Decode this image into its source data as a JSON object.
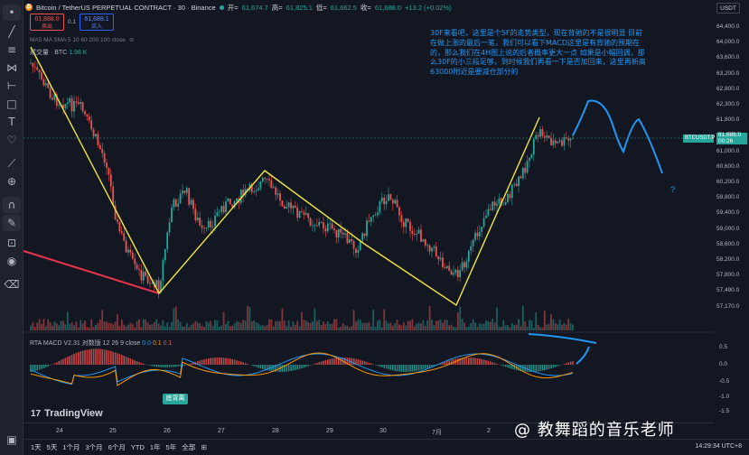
{
  "header": {
    "symbol": "Bitcoin / TetherUS PERPETUAL CONTRACT · 30 · Binance",
    "open_label": "开=",
    "open": "61,674.7",
    "high_label": "高=",
    "high": "61,825.1",
    "low_label": "低=",
    "low": "61,662.5",
    "close_label": "收=",
    "close": "61,688.0",
    "change": "+13.2 (+0.02%)"
  },
  "trade": {
    "sell_price": "61,688.0",
    "sell_label": "卖出",
    "spread": "0.1",
    "buy_price": "61,688.1",
    "buy_label": "买入"
  },
  "indicators": {
    "ma_label": "MA5 MA SMA 5 10 60 200 100 close",
    "volume_label": "成交量 · BTC",
    "volume_value": "1.98 K",
    "macd_name": "RTA MACD V2.31 对数版 12 26 9 close",
    "macd_v1": "0.0",
    "macd_v2": "0.1",
    "macd_v3": "0.1"
  },
  "currency": "USDT",
  "price_axis": [
    "64,400.0",
    "64,000.0",
    "63,600.0",
    "63,200.0",
    "62,800.0",
    "62,300.0",
    "61,800.0",
    "61,400.0",
    "61,000.0",
    "60,600.0",
    "60,200.0",
    "59,800.0",
    "59,400.0",
    "59,000.0",
    "58,600.0",
    "58,200.0",
    "57,800.0",
    "57,490.0",
    "57,170.0"
  ],
  "symbol_tag": "BTCUSDT.P",
  "current_price": "61,688.0",
  "countdown": "00:26",
  "macd_axis": [
    "0.5",
    "0.0",
    "-0.5",
    "-1.0",
    "-1.5"
  ],
  "note": "30F来看吧，这里是个5F的走势类型，现在背驰的不是很明显 目前在做上涨的最后一笔，我们可以看下MACD这里是有背驰的预期在的，那么我们在4H图上说的后者概率更大一点 如果是小幅回调，那么30F的小三段足够，到时候我们再看一下是否加回来，这里再新高63000附近是要减仓部分的",
  "question_mark": "?",
  "divergence_tag": "底背离",
  "brand": "TradingView",
  "dates": [
    "24",
    "25",
    "26",
    "27",
    "28",
    "29",
    "30",
    "7月",
    "2",
    "3"
  ],
  "ranges": [
    "1天",
    "5天",
    "1个月",
    "3个月",
    "6个月",
    "YTD",
    "1年",
    "5年",
    "全部"
  ],
  "clock": "14:29:34 UTC+8",
  "watermark": "@ 教舞蹈的音乐老师",
  "colors": {
    "up": "#26a69a",
    "down": "#ef5350",
    "wave": "#f0e442",
    "note": "#2196f3",
    "trend": "#e8344a"
  }
}
